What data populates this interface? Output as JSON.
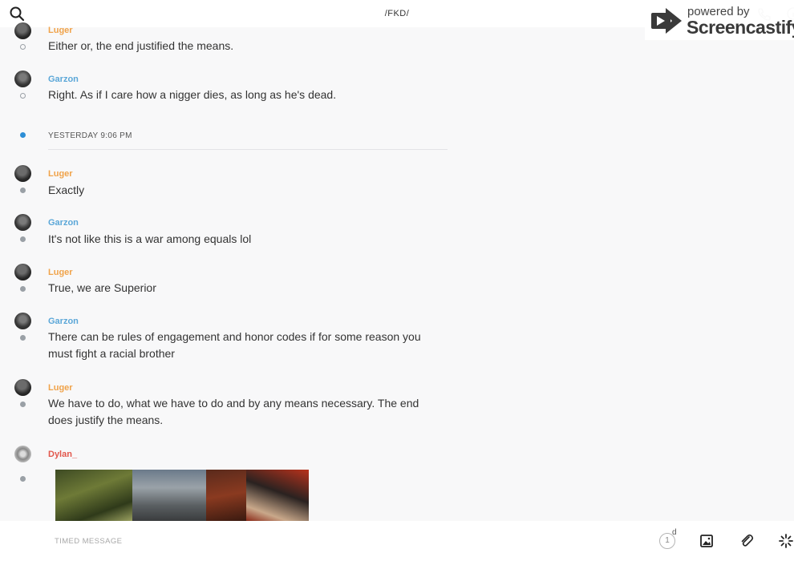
{
  "header": {
    "title": "/FKD/",
    "search_icon": "search-icon",
    "call_icon": "phone-icon",
    "info_icon": "info-icon"
  },
  "watermark": {
    "powered_by": "powered by",
    "brand": "Screencastify"
  },
  "colors": {
    "luger": "#f0a34a",
    "garzon": "#5ba7d8",
    "dylan": "#e2574c",
    "unread_dot": "#2d8ed6"
  },
  "messages_before": [
    {
      "sender": "Luger",
      "text": "Either or, the end justified the means."
    },
    {
      "sender": "Garzon",
      "text": "Right. As if I care how a nigger dies, as long as he's dead."
    }
  ],
  "day_separator": "YESTERDAY 9:06 PM",
  "messages_after": [
    {
      "sender": "Luger",
      "text": "Exactly"
    },
    {
      "sender": "Garzon",
      "text": "It's not like this is a war among equals lol"
    },
    {
      "sender": "Luger",
      "text": "True, we are Superior"
    },
    {
      "sender": "Garzon",
      "text": "There can be rules of engagement and honor codes if for some reason you must fight a racial brother"
    },
    {
      "sender": "Luger",
      "text": "We have to do, what we have to do and by any means necessary. The end does justify the means."
    },
    {
      "sender": "Dylan_",
      "attachment": "image"
    }
  ],
  "composer": {
    "placeholder": "TIMED MESSAGE",
    "timer_value": "1",
    "timer_unit": "d",
    "icons": [
      "timer-icon",
      "image-icon",
      "paperclip-icon",
      "burst-icon"
    ]
  }
}
